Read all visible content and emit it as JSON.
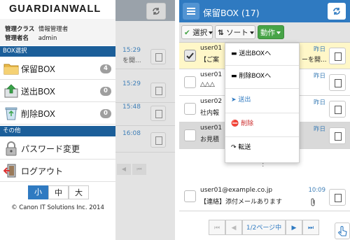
{
  "left": {
    "logo": "GUARDIANWALL",
    "user_info": {
      "class_label": "管理クラス",
      "class_value": "情報管理者",
      "name_label": "管理者名",
      "name_value": "admin"
    },
    "box_section": "BOX選択",
    "box_items": [
      {
        "label": "保留BOX",
        "count": "4"
      },
      {
        "label": "送出BOX",
        "count": "0"
      },
      {
        "label": "削除BOX",
        "count": "0"
      }
    ],
    "other_section": "その他",
    "other_items": [
      {
        "label": "パスワード変更"
      },
      {
        "label": "ログアウト"
      }
    ],
    "font_sizes": [
      "小",
      "中",
      "大"
    ],
    "font_size_selected": "小",
    "copyright": "© Canon IT Solutions Inc. 2014",
    "background_list": {
      "times": [
        "15:29",
        "15:29",
        "15:48",
        "16:08"
      ],
      "snippets": [
        "を開...",
        "",
        "",
        ""
      ]
    }
  },
  "right": {
    "title": "保留BOX (17)",
    "toolbar": {
      "select_label": "選択",
      "sort_label": "ソート",
      "action_label": "動作"
    },
    "dropdown": [
      {
        "label": "送出BOXへ",
        "icon": "folder-icon",
        "color": "#222222"
      },
      {
        "label": "削除BOXへ",
        "icon": "folder-icon",
        "color": "#222222"
      },
      {
        "label": "送出",
        "icon": "send-icon",
        "color": "#2f7ac1"
      },
      {
        "label": "削除",
        "icon": "delete-icon",
        "color": "#cc2b2b"
      },
      {
        "label": "転送",
        "icon": "forward-icon",
        "color": "#222222"
      }
    ],
    "mails": [
      {
        "sender": "user01",
        "subject": "【ご案",
        "subject_tail": "ーを開...",
        "time": "昨日",
        "checked": true
      },
      {
        "sender": "user01",
        "subject": "△△△",
        "subject_tail": "",
        "time": "昨日",
        "checked": false
      },
      {
        "sender": "user02",
        "subject": "社内報",
        "subject_tail": "",
        "time": "昨日",
        "checked": false
      },
      {
        "sender": "user01",
        "subject": "お見積",
        "subject_tail": "",
        "time": "昨日",
        "checked": false
      },
      {
        "sender": "user01@example.co.jp",
        "subject": "【連絡】添付メールあります",
        "subject_tail": "",
        "time": "10:09",
        "checked": false
      }
    ],
    "ellipsis": ":",
    "pagination": {
      "page_label": "1/2ページ中"
    }
  },
  "colors": {
    "header_blue": "#2f7ac1",
    "section_blue": "#1b5e99",
    "green_button": "#47a447",
    "selected_row": "#fff7c8",
    "time_blue": "#3f7fb7"
  }
}
